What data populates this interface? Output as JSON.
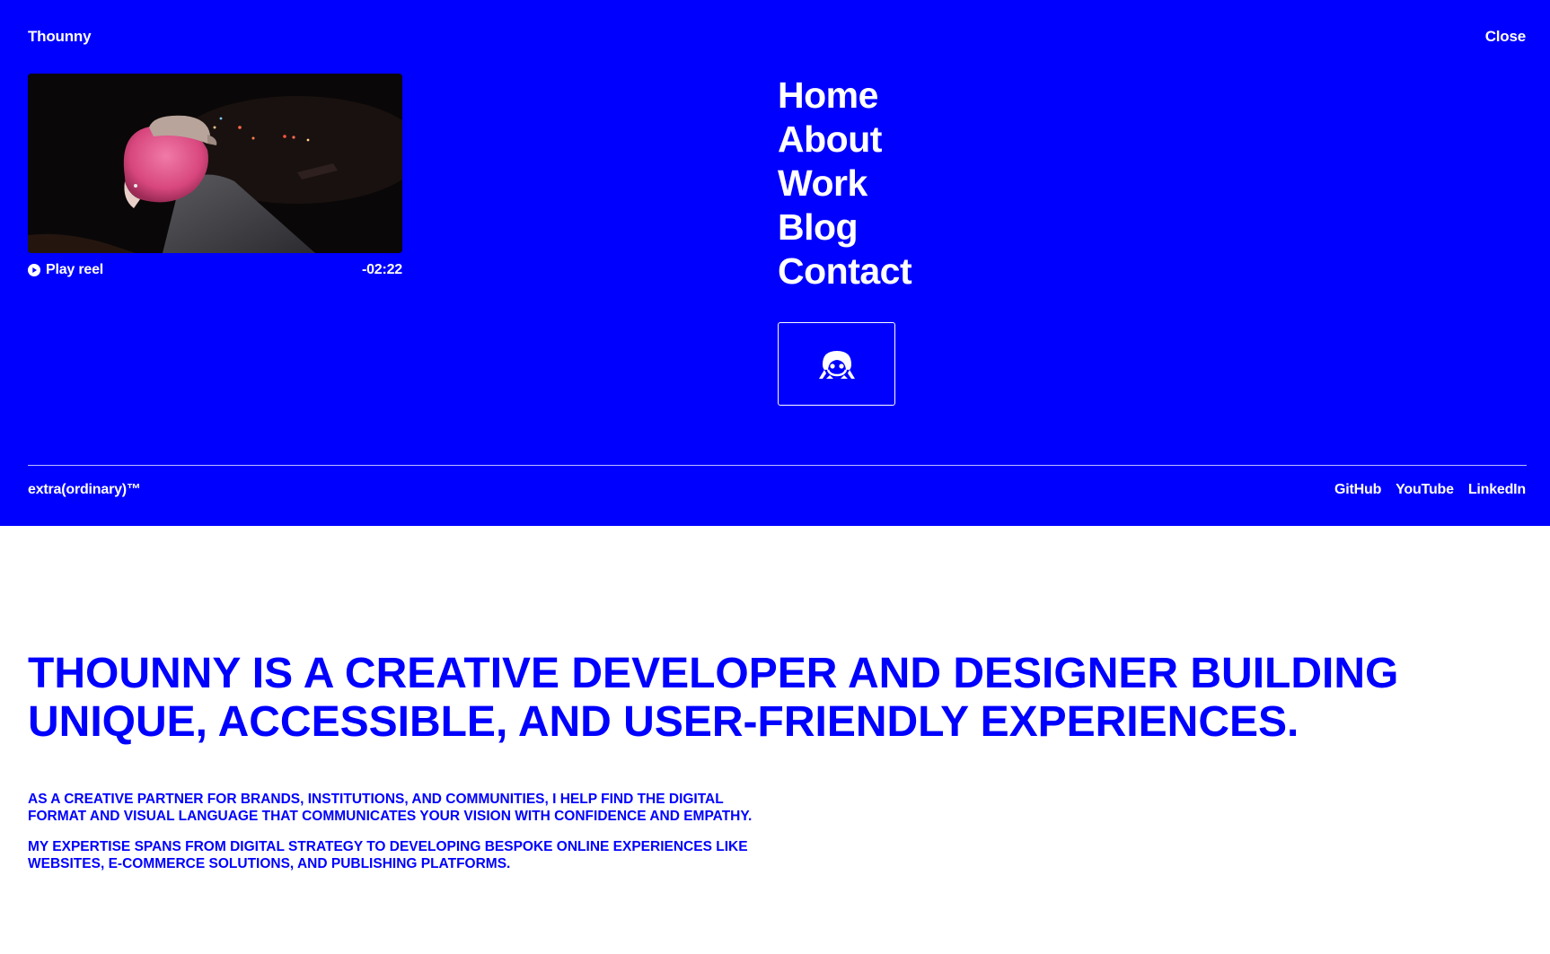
{
  "header": {
    "brand": "Thounny",
    "close_label": "Close"
  },
  "reel": {
    "play_label": "Play reel",
    "time_remaining": "-02:22"
  },
  "nav": {
    "items": [
      {
        "label": "Home"
      },
      {
        "label": "About"
      },
      {
        "label": "Work"
      },
      {
        "label": "Blog"
      },
      {
        "label": "Contact"
      }
    ]
  },
  "footer": {
    "tagline": "extra(ordinary)™",
    "social": [
      {
        "label": "GitHub"
      },
      {
        "label": "YouTube"
      },
      {
        "label": "LinkedIn"
      }
    ]
  },
  "main": {
    "headline": "THOUNNY IS A CREATIVE DEVELOPER AND DESIGNER BUILDING UNIQUE, ACCESSIBLE, AND USER-FRIENDLY EXPERIENCES.",
    "paragraphs": [
      "AS A CREATIVE PARTNER FOR BRANDS, INSTITUTIONS, AND COMMUNITIES, I HELP FIND THE DIGITAL FORMAT AND VISUAL LANGUAGE THAT COMMUNICATES YOUR VISION WITH CONFIDENCE AND EMPATHY.",
      "MY EXPERTISE SPANS FROM DIGITAL STRATEGY TO DEVELOPING BESPOKE ONLINE EXPERIENCES LIKE WEBSITES, E-COMMERCE SOLUTIONS, AND PUBLISHING PLATFORMS."
    ]
  },
  "colors": {
    "accent": "#0000fe",
    "background": "#ffffff",
    "on_accent": "#ffffff"
  },
  "icons": {
    "play": "play-circle-icon",
    "logo": "mascot-logo-icon"
  }
}
